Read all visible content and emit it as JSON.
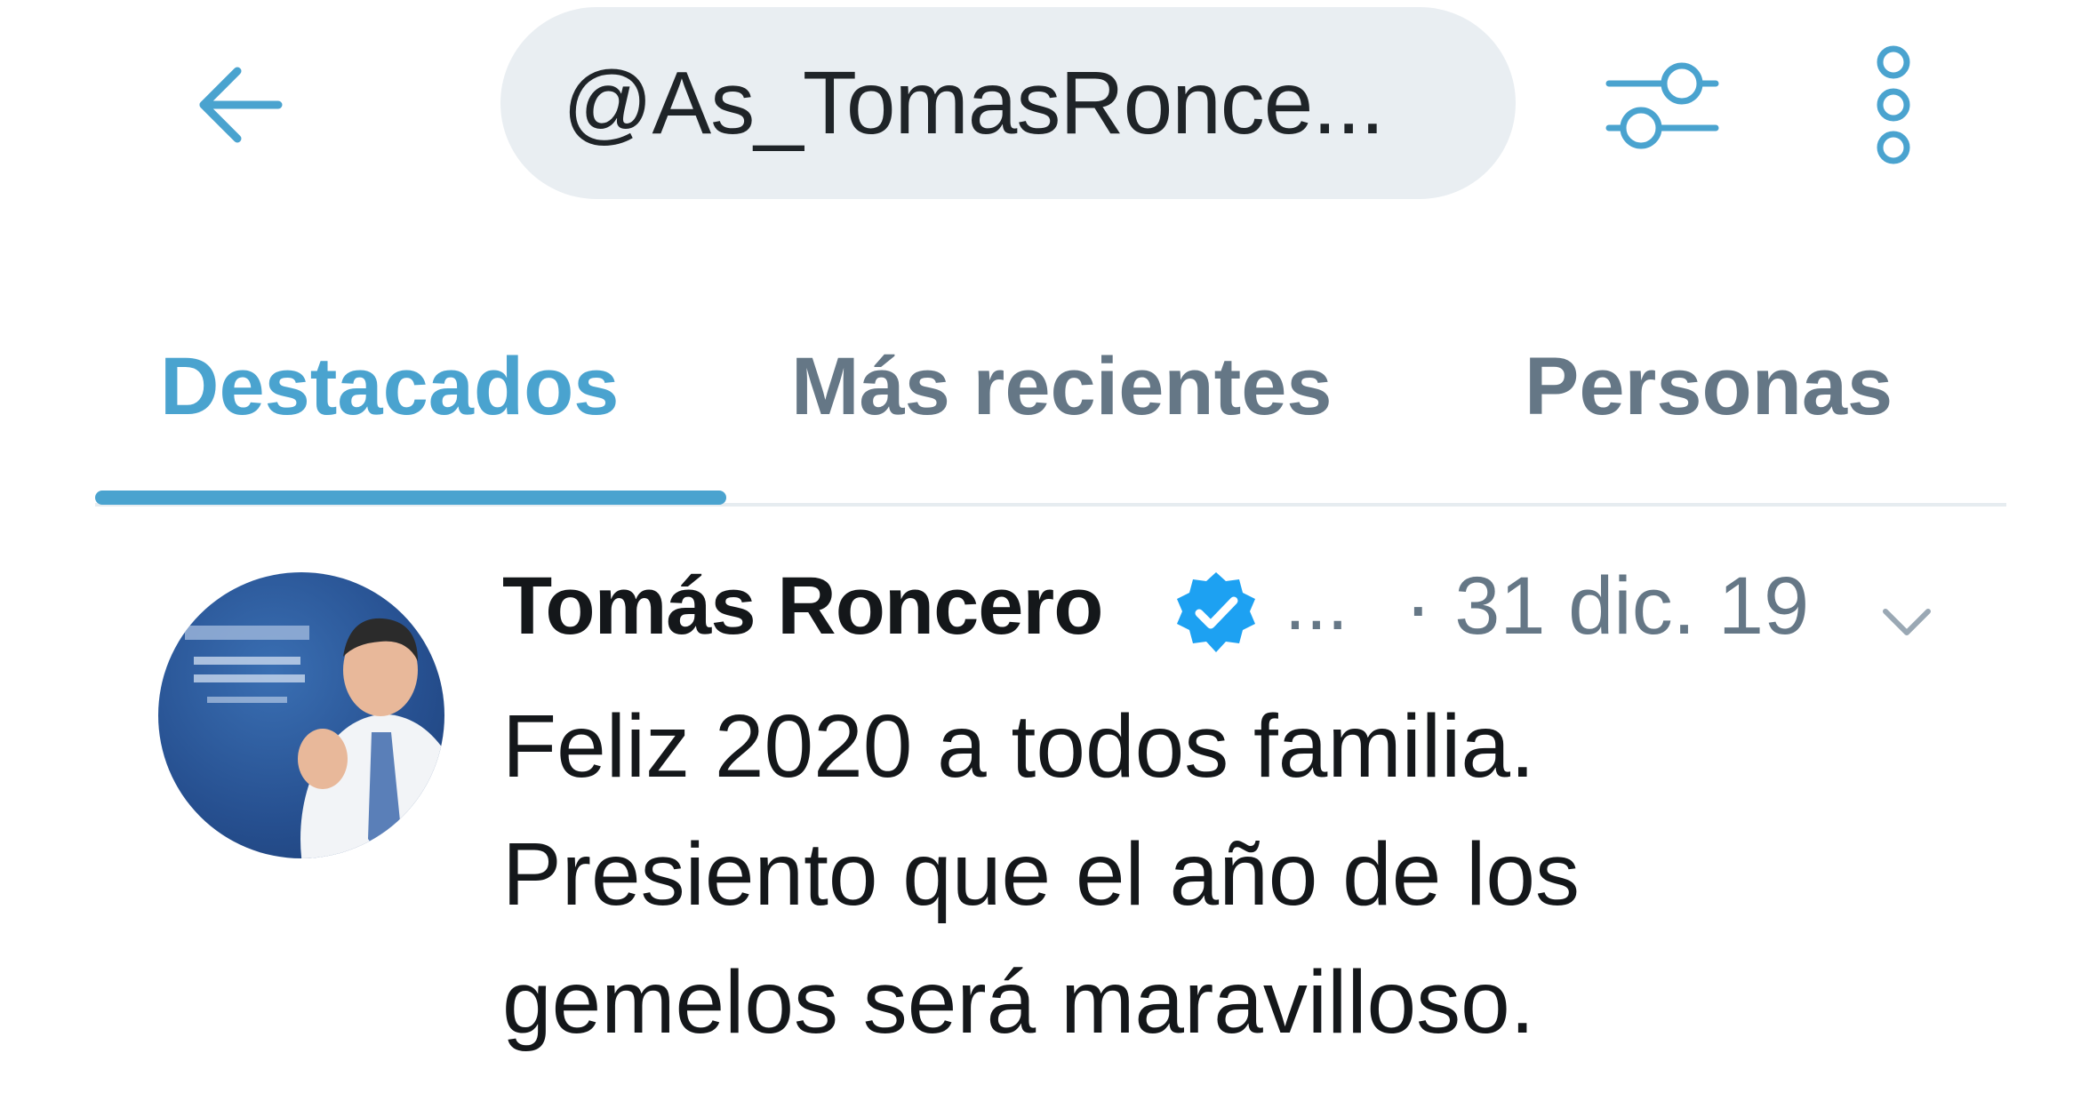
{
  "topbar": {
    "back_icon": "arrow-left-icon",
    "search_query": "@As_TomasRonce...",
    "filter_icon": "sliders-icon",
    "more_icon": "vertical-dots-icon"
  },
  "tabs": [
    {
      "label": "Destacados",
      "active": true
    },
    {
      "label": "Más recientes",
      "active": false
    },
    {
      "label": "Personas",
      "active": false
    }
  ],
  "tweet": {
    "author_name": "Tomás Roncero",
    "verified": true,
    "handle_truncated": "...",
    "date": "· 31 dic. 19",
    "text_lines": [
      "Feliz 2020 a todos familia.",
      "Presiento que el año de los",
      "gemelos será maravilloso."
    ],
    "avatar_icon": "profile-photo",
    "caret_icon": "chevron-down-icon"
  },
  "colors": {
    "accent": "#4aa3cf",
    "icon": "#4aa3cf",
    "muted": "#657786",
    "text": "#14171a",
    "search_bg": "#e9eef2"
  }
}
